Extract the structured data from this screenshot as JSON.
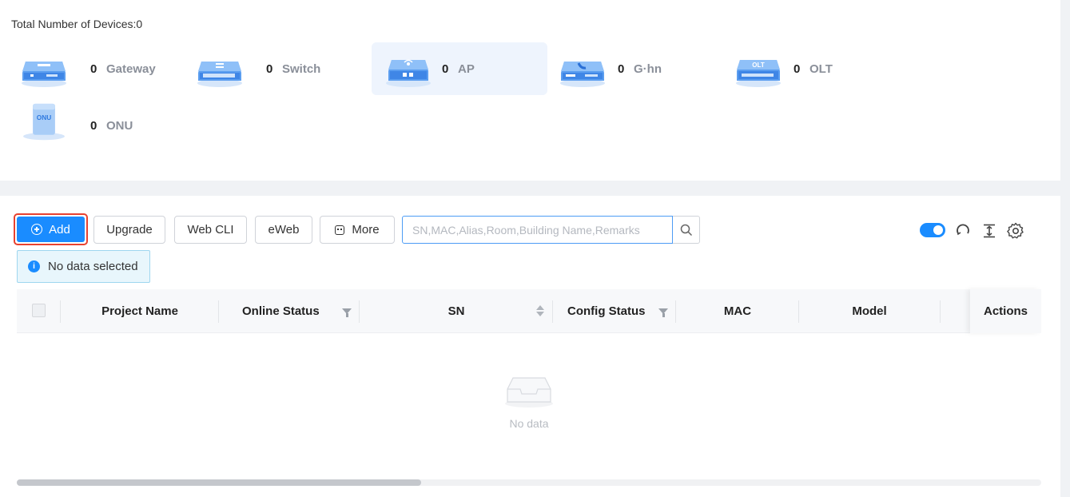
{
  "summary": {
    "total_label": "Total Number of Devices:0",
    "devices": [
      {
        "count": "0",
        "name": "Gateway",
        "icon": "gateway-device-icon",
        "active": false
      },
      {
        "count": "0",
        "name": "Switch",
        "icon": "switch-device-icon",
        "active": false
      },
      {
        "count": "0",
        "name": "AP",
        "icon": "ap-device-icon",
        "active": true
      },
      {
        "count": "0",
        "name": "G·hn",
        "icon": "ghn-device-icon",
        "active": false
      },
      {
        "count": "0",
        "name": "OLT",
        "icon": "olt-device-icon",
        "active": false,
        "badge": "OLT"
      },
      {
        "count": "0",
        "name": "ONU",
        "icon": "onu-device-icon",
        "active": false,
        "badge": "ONU"
      }
    ]
  },
  "toolbar": {
    "add_label": "Add",
    "upgrade_label": "Upgrade",
    "webcli_label": "Web CLI",
    "eweb_label": "eWeb",
    "more_label": "More",
    "search_placeholder": "SN,MAC,Alias,Room,Building Name,Remarks",
    "search_value": ""
  },
  "notice": {
    "text": "No data selected"
  },
  "table": {
    "columns": [
      "Project Name",
      "Online Status",
      "SN",
      "Config Status",
      "MAC",
      "Model",
      "Actions"
    ],
    "rows": [],
    "empty_text": "No data"
  },
  "colors": {
    "primary": "#1a8cff",
    "highlight_border": "#e8412f",
    "active_card": "#eef4fd"
  }
}
